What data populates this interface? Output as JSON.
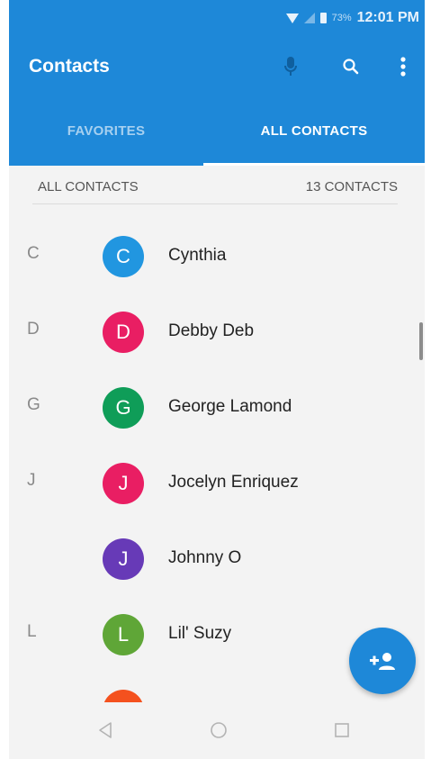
{
  "status_bar": {
    "battery": "73%",
    "time": "12:01 PM"
  },
  "app_bar": {
    "title": "Contacts",
    "actions": [
      "mic-icon",
      "search-icon",
      "more-vert-icon"
    ]
  },
  "tabs": [
    {
      "label": "FAVORITES",
      "selected": false
    },
    {
      "label": "ALL CONTACTS",
      "selected": true
    }
  ],
  "list_header": {
    "left": "ALL CONTACTS",
    "right": "13 CONTACTS"
  },
  "contacts": [
    {
      "section": "C",
      "initial": "C",
      "name": "Cynthia",
      "color": "#2196e0"
    },
    {
      "section": "D",
      "initial": "D",
      "name": "Debby Deb",
      "color": "#e91e63"
    },
    {
      "section": "G",
      "initial": "G",
      "name": "George Lamond",
      "color": "#0f9d58"
    },
    {
      "section": "J",
      "initial": "J",
      "name": "Jocelyn Enriquez",
      "color": "#e91e63"
    },
    {
      "section": "",
      "initial": "J",
      "name": "Johnny O",
      "color": "#673ab7"
    },
    {
      "section": "L",
      "initial": "L",
      "name": "Lil' Suzy",
      "color": "#5fa637"
    }
  ],
  "partial_row": {
    "color": "#f4511e"
  },
  "fab": {
    "icon": "add-contact-icon"
  },
  "colors": {
    "primary": "#1e88d8",
    "background": "#f3f3f3"
  }
}
